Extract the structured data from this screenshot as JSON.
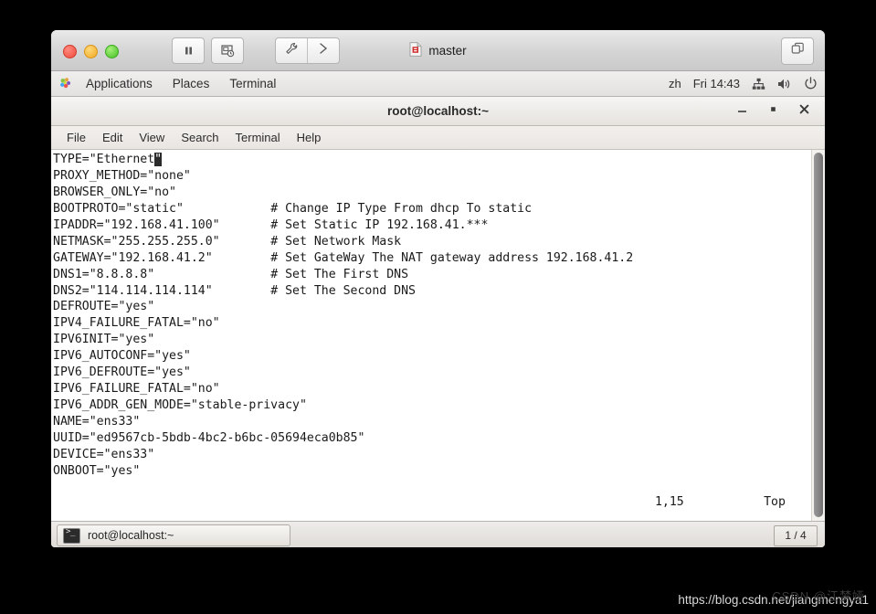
{
  "vm": {
    "title": "master",
    "title_icon": "document-icon",
    "traffic_lights": [
      "close-red",
      "minimize-yellow",
      "maximize-green"
    ],
    "toolbar": {
      "pause": "pause-icon",
      "snapshot": "snapshot-icon",
      "settings": "wrench-icon",
      "expand": "chevron-right-icon"
    },
    "restore": "restore-window-icon"
  },
  "gnome_panel": {
    "menus": [
      "Applications",
      "Places",
      "Terminal"
    ],
    "logo": "gnome-foot-icon",
    "input_method": "zh",
    "clock": "Fri 14:43",
    "tray": [
      "network-icon",
      "volume-icon",
      "power-icon"
    ]
  },
  "terminal": {
    "title": "root@localhost:~",
    "window_controls": [
      "minimize",
      "maximize",
      "close"
    ],
    "menubar": [
      "File",
      "Edit",
      "View",
      "Search",
      "Terminal",
      "Help"
    ],
    "lines": [
      {
        "code": "TYPE=\"Ethernet",
        "cursor": "\"",
        "tail": "",
        "comment": ""
      },
      {
        "code": "PROXY_METHOD=\"none\"",
        "cursor": "",
        "tail": "",
        "comment": ""
      },
      {
        "code": "BROWSER_ONLY=\"no\"",
        "cursor": "",
        "tail": "",
        "comment": ""
      },
      {
        "code": "BOOTPROTO=\"static\"",
        "cursor": "",
        "tail": "",
        "comment": "# Change IP Type From dhcp To static"
      },
      {
        "code": "IPADDR=\"192.168.41.100\"",
        "cursor": "",
        "tail": "",
        "comment": "# Set Static IP 192.168.41.***"
      },
      {
        "code": "NETMASK=\"255.255.255.0\"",
        "cursor": "",
        "tail": "",
        "comment": "# Set Network Mask"
      },
      {
        "code": "GATEWAY=\"192.168.41.2\"",
        "cursor": "",
        "tail": "",
        "comment": "# Set GateWay The NAT gateway address 192.168.41.2"
      },
      {
        "code": "DNS1=\"8.8.8.8\"",
        "cursor": "",
        "tail": "",
        "comment": "# Set The First DNS"
      },
      {
        "code": "DNS2=\"114.114.114.114\"",
        "cursor": "",
        "tail": "",
        "comment": "# Set The Second DNS"
      },
      {
        "code": "DEFROUTE=\"yes\"",
        "cursor": "",
        "tail": "",
        "comment": ""
      },
      {
        "code": "IPV4_FAILURE_FATAL=\"no\"",
        "cursor": "",
        "tail": "",
        "comment": ""
      },
      {
        "code": "IPV6INIT=\"yes\"",
        "cursor": "",
        "tail": "",
        "comment": ""
      },
      {
        "code": "IPV6_AUTOCONF=\"yes\"",
        "cursor": "",
        "tail": "",
        "comment": ""
      },
      {
        "code": "IPV6_DEFROUTE=\"yes\"",
        "cursor": "",
        "tail": "",
        "comment": ""
      },
      {
        "code": "IPV6_FAILURE_FATAL=\"no\"",
        "cursor": "",
        "tail": "",
        "comment": ""
      },
      {
        "code": "IPV6_ADDR_GEN_MODE=\"stable-privacy\"",
        "cursor": "",
        "tail": "",
        "comment": ""
      },
      {
        "code": "NAME=\"ens33\"",
        "cursor": "",
        "tail": "",
        "comment": ""
      },
      {
        "code": "UUID=\"ed9567cb-5bdb-4bc2-b6bc-05694eca0b85\"",
        "cursor": "",
        "tail": "",
        "comment": ""
      },
      {
        "code": "DEVICE=\"ens33\"",
        "cursor": "",
        "tail": "",
        "comment": ""
      },
      {
        "code": "ONBOOT=\"yes\"",
        "cursor": "",
        "tail": "",
        "comment": ""
      }
    ],
    "status": {
      "position": "1,15",
      "scroll": "Top"
    }
  },
  "taskbar": {
    "item_label": "root@localhost:~",
    "item_icon": "terminal-icon",
    "workspace": "1 / 4"
  },
  "watermark": {
    "url": "https://blog.csdn.net/jiangmengya1",
    "overlay": "CSDN @江梦娅"
  }
}
